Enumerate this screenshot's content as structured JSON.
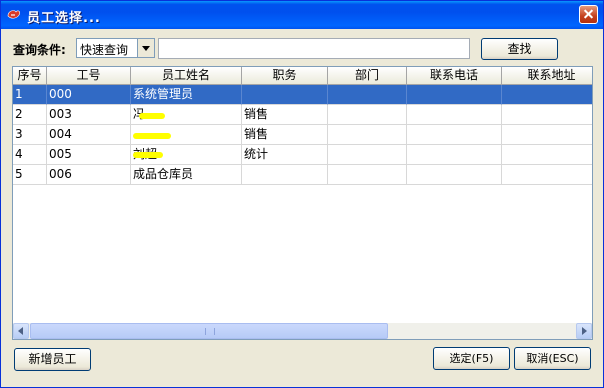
{
  "window": {
    "title": "员工选择..."
  },
  "search": {
    "label": "查询条件:",
    "mode": "快速查询",
    "query": "",
    "find_label": "查找"
  },
  "table": {
    "columns": [
      "序号",
      "工号",
      "员工姓名",
      "职务",
      "部门",
      "联系电话",
      "联系地址"
    ],
    "rows": [
      {
        "seq": "1",
        "id": "000",
        "name": "系统管理员",
        "title": "",
        "dept": "",
        "phone": "",
        "address": ""
      },
      {
        "seq": "2",
        "id": "003",
        "name": "冯",
        "title": "销售",
        "dept": "",
        "phone": "",
        "address": ""
      },
      {
        "seq": "3",
        "id": "004",
        "name": "",
        "title": "销售",
        "dept": "",
        "phone": "",
        "address": ""
      },
      {
        "seq": "4",
        "id": "005",
        "name": "刘超",
        "title": "统计",
        "dept": "",
        "phone": "",
        "address": ""
      },
      {
        "seq": "5",
        "id": "006",
        "name": "成品仓库员",
        "title": "",
        "dept": "",
        "phone": "",
        "address": ""
      }
    ],
    "selected_row": 1
  },
  "buttons": {
    "add": "新增员工",
    "ok": "选定(F5)",
    "cancel": "取消(ESC)"
  },
  "colors": {
    "titlebar": "#0053ee",
    "selection": "#316ac5",
    "redaction": "#ffff00"
  },
  "icons": {
    "app": "app-icon",
    "close": "close-icon",
    "dropdown": "chevron-down-icon"
  }
}
